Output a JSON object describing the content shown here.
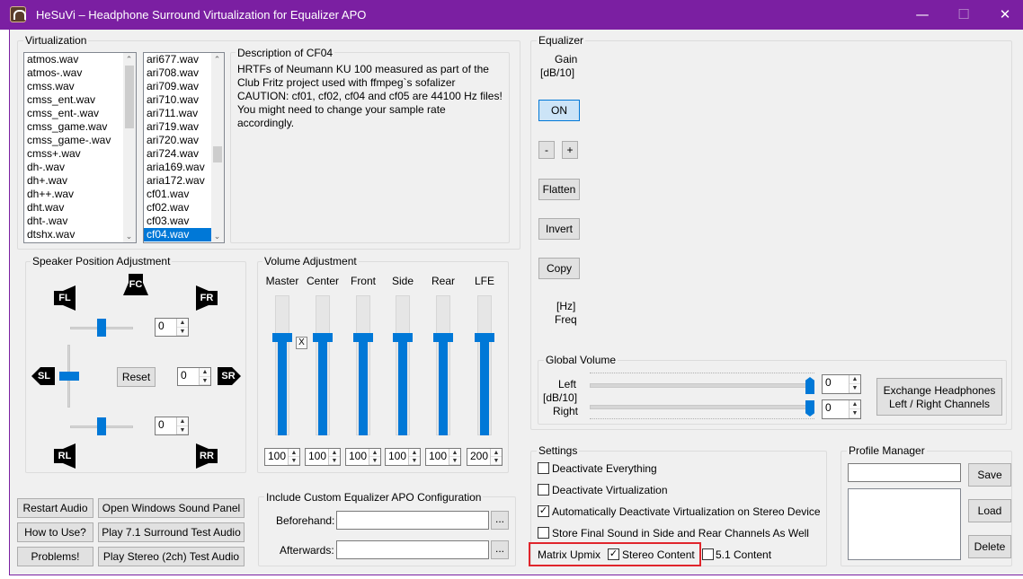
{
  "window": {
    "title": "HeSuVi – Headphone Surround Virtualization for Equalizer APO",
    "minimize_icon": "minimize-icon",
    "maximize_icon": "maximize-icon",
    "close_icon": "close-icon",
    "accent": "#7b1fa2"
  },
  "virtualization": {
    "group_label": "Virtualization",
    "list1": [
      "atmos.wav",
      "atmos-.wav",
      "cmss.wav",
      "cmss_ent.wav",
      "cmss_ent-.wav",
      "cmss_game.wav",
      "cmss_game-.wav",
      "cmss+.wav",
      "dh-.wav",
      "dh+.wav",
      "dh++.wav",
      "dht.wav",
      "dht-.wav",
      "dtshx.wav"
    ],
    "list2": [
      "ari677.wav",
      "ari708.wav",
      "ari709.wav",
      "ari710.wav",
      "ari711.wav",
      "ari719.wav",
      "ari720.wav",
      "ari724.wav",
      "aria169.wav",
      "aria172.wav",
      "cf01.wav",
      "cf02.wav",
      "cf03.wav",
      "cf04.wav"
    ],
    "list2_selected": "cf04.wav",
    "desc_label": "Description of CF04",
    "desc_lines": [
      "HRTFs of Neumann KU 100 measured as part of the",
      "Club Fritz project used with ffmpeg`s sofalizer",
      "CAUTION: cf01, cf02, cf04 and cf05 are 44100 Hz files!",
      "You might need to change your sample rate",
      "accordingly."
    ]
  },
  "speaker": {
    "group_label": "Speaker Position Adjustment",
    "labels": {
      "fl": "FL",
      "fc": "FC",
      "fr": "FR",
      "sl": "SL",
      "sr": "SR",
      "rl": "RL",
      "rr": "RR"
    },
    "front_value": "0",
    "side_value": "0",
    "rear_value": "0",
    "reset_label": "Reset"
  },
  "volume": {
    "group_label": "Volume Adjustment",
    "channels": [
      {
        "name": "Master",
        "value": "100",
        "level": 1.0
      },
      {
        "name": "Center",
        "value": "100",
        "level": 1.0
      },
      {
        "name": "Front",
        "value": "100",
        "level": 1.0
      },
      {
        "name": "Side",
        "value": "100",
        "level": 1.0
      },
      {
        "name": "Rear",
        "value": "100",
        "level": 1.0
      },
      {
        "name": "LFE",
        "value": "200",
        "level": 1.0
      }
    ],
    "x_label": "X"
  },
  "buttons": {
    "restart_audio": "Restart Audio",
    "open_sound_panel": "Open Windows Sound Panel",
    "how_to_use": "How to Use?",
    "play_71": "Play 7.1 Surround Test Audio",
    "problems": "Problems!",
    "play_stereo": "Play Stereo (2ch) Test Audio"
  },
  "custom_eq": {
    "group_label": "Include Custom Equalizer APO Configuration",
    "beforehand_label": "Beforehand:",
    "afterwards_label": "Afterwards:",
    "beforehand_value": "",
    "afterwards_value": "",
    "browse_label": "..."
  },
  "equalizer": {
    "group_label": "Equalizer",
    "gain_label": "Gain",
    "gain_unit": "[dB/10]",
    "on_label": "ON",
    "minus_label": "-",
    "plus_label": "+",
    "flatten_label": "Flatten",
    "invert_label": "Invert",
    "copy_label": "Copy",
    "hz_label": "[Hz]",
    "freq_label": "Freq"
  },
  "global_volume": {
    "group_label": "Global Volume",
    "left_label": "Left",
    "unit_label": "[dB/10]",
    "right_label": "Right",
    "left_value": "0",
    "right_value": "0",
    "exchange_line1": "Exchange Headphones",
    "exchange_line2": "Left / Right Channels"
  },
  "settings": {
    "group_label": "Settings",
    "deactivate_everything": "Deactivate Everything",
    "deactivate_virtualization": "Deactivate Virtualization",
    "auto_deactivate": "Automatically Deactivate Virtualization on Stereo Device",
    "store_final": "Store Final Sound in Side and Rear Channels As Well",
    "matrix_upmix": "Matrix Upmix",
    "stereo_content": "Stereo Content",
    "content_51": "5.1 Content",
    "check_mark": "✓"
  },
  "profile": {
    "group_label": "Profile Manager",
    "save_label": "Save",
    "load_label": "Load",
    "delete_label": "Delete",
    "name_value": ""
  }
}
